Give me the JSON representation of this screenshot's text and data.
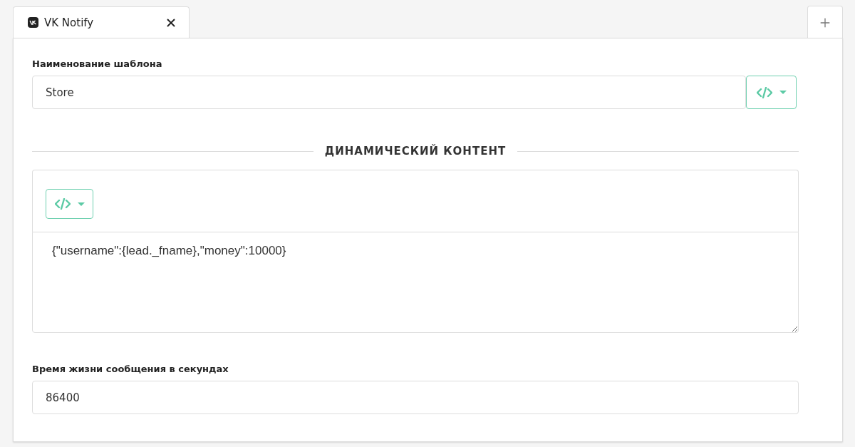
{
  "tabs": [
    {
      "label": "VK Notify",
      "selected": true
    }
  ],
  "form": {
    "name_label": "Наименование шаблона",
    "name_value": "Store",
    "section_title": "ДИНАМИЧЕСКИЙ КОНТЕНТ",
    "content_value": "{\"username\":{lead._fname},\"money\":10000}",
    "ttl_label": "Время жизни сообщения в секундах",
    "ttl_value": "86400"
  }
}
